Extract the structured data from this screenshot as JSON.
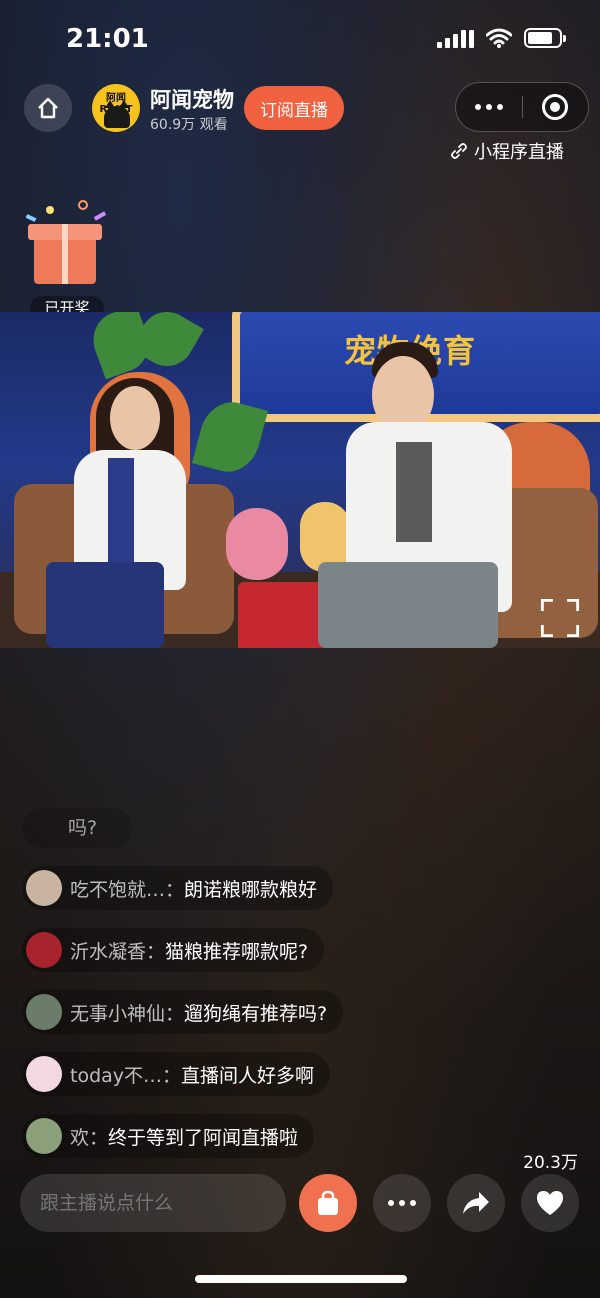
{
  "status_bar": {
    "time": "21:01",
    "battery_level": 0.8
  },
  "header": {
    "avatar_text": "阿闻 R·VET",
    "host_name": "阿闻宠物",
    "viewers": "60.9万 观看",
    "subscribe_label": "订阅直播",
    "mini_program_label": "小程序直播"
  },
  "gift": {
    "label": "已开奖"
  },
  "video": {
    "screen_text": "宠物绝育"
  },
  "chat": {
    "faded": "吗?",
    "messages": [
      {
        "name": "吃不饱就…",
        "text": "朗诺粮哪款粮好",
        "avatar_color": "#c8b4a0"
      },
      {
        "name": "沂水凝香",
        "text": "猫粮推荐哪款呢?",
        "avatar_color": "#a8242c"
      },
      {
        "name": "无事小神仙",
        "text": "遛狗绳有推荐吗?",
        "avatar_color": "#6b7d6a"
      },
      {
        "name": "today不…",
        "text": "直播间人好多啊",
        "avatar_color": "#f3d9e2"
      },
      {
        "name": "欢",
        "text": "终于等到了阿闻直播啦",
        "avatar_color": "#8aa07a"
      }
    ]
  },
  "bottom": {
    "like_count": "20.3万",
    "comment_placeholder": "跟主播说点什么"
  },
  "colors": {
    "accent": "#f0613f",
    "shop": "#f0714f"
  }
}
